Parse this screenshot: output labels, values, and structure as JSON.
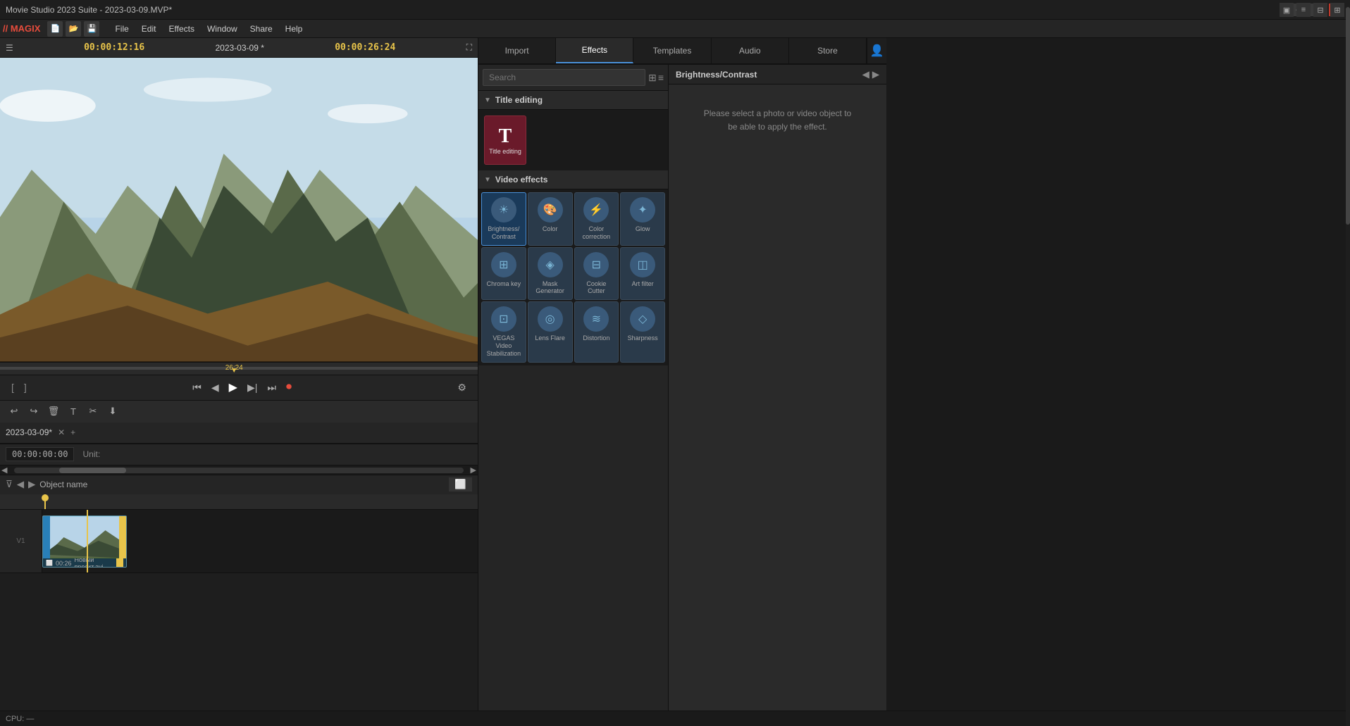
{
  "app": {
    "title": "Movie Studio 2023 Suite - 2023-03-09.MVP*",
    "logo": "// MAGIX"
  },
  "titlebar": {
    "title": "Movie Studio 2023 Suite - 2023-03-09.MVP*",
    "minimize": "—",
    "restore": "⬜",
    "close": "✕"
  },
  "menubar": {
    "items": [
      "File",
      "Edit",
      "Effects",
      "Window",
      "Share",
      "Help"
    ]
  },
  "transport": {
    "current_time": "00:00:12:16",
    "date": "2023-03-09 *",
    "total_time": "00:00:26:24",
    "scrubber_time": "26:24"
  },
  "transport_controls": {
    "mark_in": "[",
    "mark_out": "]",
    "prev_marker": "⏮",
    "prev_frame": "◀",
    "play": "▶",
    "next_frame": "▶",
    "next_marker": "⏭",
    "record": "⏺"
  },
  "toolbar": {
    "undo": "↩",
    "redo": "↪",
    "delete": "🗑",
    "text": "T",
    "scissors": "✂",
    "import": "⬇"
  },
  "effects_panel": {
    "tabs": [
      {
        "id": "import",
        "label": "Import"
      },
      {
        "id": "effects",
        "label": "Effects"
      },
      {
        "id": "templates",
        "label": "Templates"
      },
      {
        "id": "audio",
        "label": "Audio"
      },
      {
        "id": "store",
        "label": "Store"
      }
    ],
    "active_tab": "effects",
    "search_placeholder": "Search",
    "sections": [
      {
        "id": "title-editing",
        "label": "Title editing",
        "items": [
          {
            "id": "title-editing",
            "label": "Title editing",
            "icon": "T",
            "type": "title"
          }
        ]
      },
      {
        "id": "video-effects",
        "label": "Video effects",
        "items": [
          {
            "id": "brightness-contrast",
            "label": "Brightness/ Contrast",
            "icon": "☀"
          },
          {
            "id": "color",
            "label": "Color",
            "icon": "🎨"
          },
          {
            "id": "color-correction",
            "label": "Color correction",
            "icon": "⚡"
          },
          {
            "id": "glow",
            "label": "Glow",
            "icon": "✦"
          },
          {
            "id": "chroma-key",
            "label": "Chroma key",
            "icon": "⊞"
          },
          {
            "id": "mask-generator",
            "label": "Mask Generator",
            "icon": "◈"
          },
          {
            "id": "cookie-cutter",
            "label": "Cookie Cutter",
            "icon": "⊟"
          },
          {
            "id": "art-filter",
            "label": "Art filter",
            "icon": "◫"
          },
          {
            "id": "vegas-stabilization",
            "label": "VEGAS Video Stabilization",
            "icon": "⊡"
          },
          {
            "id": "lens-flare",
            "label": "Lens Flare",
            "icon": "◎"
          },
          {
            "id": "distortion",
            "label": "Distortion",
            "icon": "≋"
          },
          {
            "id": "sharpness",
            "label": "Sharpness",
            "icon": "◇"
          }
        ]
      }
    ]
  },
  "detail_panel": {
    "title": "Brightness/Contrast",
    "placeholder_text": "Please select a photo or video object to be able to apply the effect."
  },
  "timeline": {
    "project_name": "2023-03-09*",
    "time_code": "00:00:00:00",
    "unit_label": "Unit:",
    "object_name": "Object name",
    "clip": {
      "duration": "00:26",
      "name": "Новый проект.avi"
    }
  },
  "statusbar": {
    "cpu": "CPU: —"
  }
}
